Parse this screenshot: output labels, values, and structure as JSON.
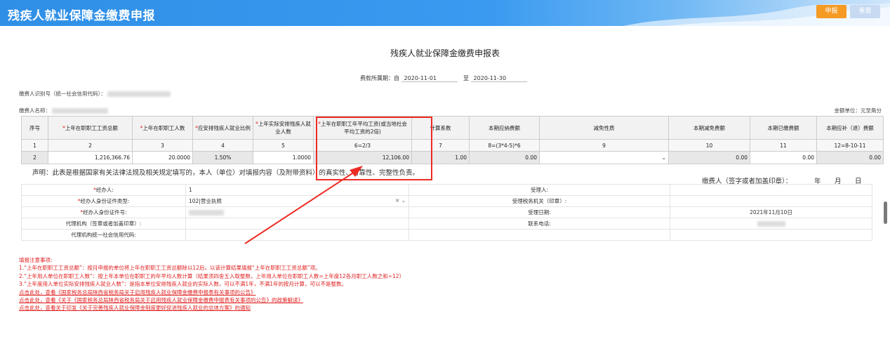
{
  "header": {
    "title": "残疾人就业保障金缴费申报",
    "submit_label": "申报",
    "reset_label": "重置"
  },
  "form": {
    "title": "残疾人就业保障金缴费申报表",
    "period_label": "费款所属期：自",
    "period_from": "2020-11-01",
    "period_to_label": "至",
    "period_to": "2020-11-30",
    "payer_id_label": "缴费人识别号（统一社会信用代码）：",
    "payer_name_label": "缴费人名称：",
    "unit_label": "金额单位：元至角分"
  },
  "table": {
    "headers": [
      {
        "req": "",
        "text": "序号"
      },
      {
        "req": "*",
        "text": "上年在职职工工资总额"
      },
      {
        "req": "*",
        "text": "上年在职职工人数"
      },
      {
        "req": "*",
        "text": "应安排残疾人就业比例"
      },
      {
        "req": "*",
        "text": "上年实际安排残疾人就业人数"
      },
      {
        "req": "*",
        "text": "上年在职职工年平均工资(或当地社会平均工资的2倍)"
      },
      {
        "req": "",
        "text": "计算系数"
      },
      {
        "req": "",
        "text": "本期应纳费额"
      },
      {
        "req": "",
        "text": "减免性质"
      },
      {
        "req": "",
        "text": "本期减免费额"
      },
      {
        "req": "",
        "text": "本期已缴费额"
      },
      {
        "req": "",
        "text": "本期应补（退）费额"
      }
    ],
    "numbers": [
      "1",
      "2",
      "3",
      "4",
      "5",
      "6=2/3",
      "7",
      "8=(3*4-5)*6",
      "9",
      "10",
      "11",
      "12=8-10-11"
    ],
    "input_row": [
      "2",
      "1,216,366.76",
      "20.0000",
      "1.50%",
      "1.0000",
      "12,106.00",
      "1.00",
      "0.00",
      "",
      "0.00",
      "0.00",
      "0.00"
    ]
  },
  "declaration": {
    "text": "声明：此表是根据国家有关法律法规及相关规定填写的，本人（单位）对填报内容（及附带资料）的真实性、可靠性、完整性负责。",
    "sign_label": "缴费人（签字或者加盖印章）：",
    "year": "年",
    "month": "月",
    "day": "日"
  },
  "agent": {
    "handler_label": "经办人:",
    "handler_value": "1",
    "id_type_label": "经办人身份证件类型:",
    "id_type_value": "102|营业执照",
    "id_no_label": "经办人身份证件号:",
    "agency_label": "代理机构（签章或者加盖印章）:",
    "agency_code_label": "代理机构统一社会信用代码:",
    "acceptor_label": "受理人:",
    "tax_office_label": "受理税务机关（印章）:",
    "accept_date_label": "受理日期:",
    "accept_date_value": "2021年11月10日",
    "phone_label": "联系电话:"
  },
  "notes": {
    "title": "填报注意事项:",
    "items": [
      "1.“上年在职职工工资总额”：按月申报的单位将上年在职职工工资总额除以12后，以该计算结果填报“上年在职职工工资总额”项。",
      "2.“上年用人单位在职职工人数”：按上年本单位在职职工的年平均人数计算（结果须四舍五入取整数，上年用人单位在职职工人数=上年度12各月职工人数之和÷12）",
      "3.“上年度用人单位实际安排残疾人就业人数”：是指本单位安排残疾人就业的实际人数，可以不满1年，不满1年的按月计算，可以不是整数。"
    ],
    "links": [
      "点击此处，查看《国家税务总局陕西省税务局关于启用残疾人就业保障金缴费申报表有关事项的公告》",
      "点击此处，查看《关于《国家税务总局陕西省税务局关于启用残疾人就业保障金缴费申报表有关事项的公告》的政策解读》",
      "点击此处，查看关于印发《关于完善残疾人就业保障金制度更好促进残疾人就业的总体方案》的通知"
    ]
  },
  "colors": {
    "header_blue": "#2f8fe6",
    "submit_orange": "#f59a23",
    "reset_blue": "#c7daf2",
    "annotation_red": "#ee2a24",
    "note_red": "#e02020"
  }
}
